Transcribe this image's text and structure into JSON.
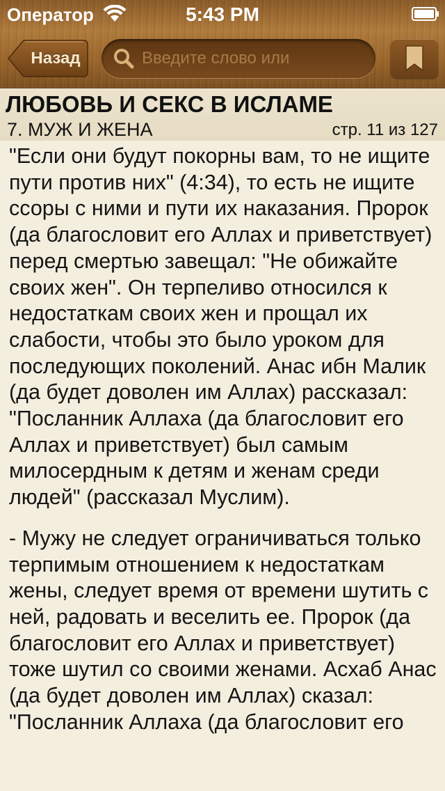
{
  "status_bar": {
    "carrier": "Оператор",
    "time": "5:43 PM",
    "wifi_icon": "wifi-icon",
    "battery_icon": "battery-icon"
  },
  "toolbar": {
    "back_label": "Назад",
    "search_placeholder": "Введите слово или",
    "search_value": "",
    "search_icon": "search-icon",
    "bookmark_icon": "bookmark-icon"
  },
  "header": {
    "book_title": "ЛЮБОВЬ И СЕКС В ИСЛАМЕ",
    "chapter_title": "7. МУЖ И ЖЕНА",
    "page_indicator": "стр. 11 из 127"
  },
  "content": {
    "paragraphs": [
      "\"Если они будут покорны вам, то не ищите пути против них\" (4:34), то есть не ищите ссоры с ними и пути их наказания. Пророк (да благословит его Аллах и приветствует) перед смертью завещал: \"Не обижайте своих жен\". Он терпеливо относился к недостаткам своих жен и прощал их слабости, чтобы это было уроком для последующих поколений. Анас ибн Малик (да будет доволен им Аллах) рассказал: \"Посланник Аллаха (да благословит его Аллах и приветствует) был самым милосердным к детям и женам среди людей\" (рассказал Муслим).",
      "- Мужу не следует ограничиваться только терпимым отношением к недостаткам жены, следует время от времени шутить с ней, радовать и веселить ее. Пророк (да благословит его Аллах и приветствует) тоже шутил со своими женами. Асхаб Анас (да будет доволен им Аллах) сказал: \"Посланник Аллаха (да благословит его"
    ]
  },
  "colors": {
    "wood_dark": "#7c4f1f",
    "wood_light": "#b07a3a",
    "paper": "#f4eedf",
    "header_paper": "#ece3cd",
    "text": "#151515"
  }
}
